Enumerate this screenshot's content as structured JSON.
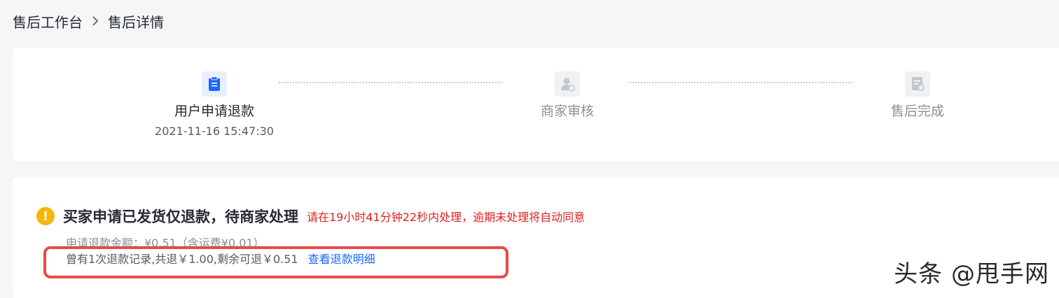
{
  "breadcrumb": {
    "parent": "售后工作台",
    "current": "售后详情"
  },
  "steps": [
    {
      "title": "用户申请退款",
      "time": "2021-11-16 15:47:30",
      "icon": "clipboard-icon",
      "active": true
    },
    {
      "title": "商家审核",
      "time": "",
      "icon": "user-review-icon",
      "active": false
    },
    {
      "title": "售后完成",
      "time": "",
      "icon": "document-check-icon",
      "active": false
    }
  ],
  "status": {
    "title": "买家申请已发货仅退款，待商家处理",
    "deadline": "请在19小时41分钟22秒内处理，逾期未处理将自动同意",
    "apply_amount": "申请退款金额：¥0.51（含运费¥0.01）",
    "record": "曾有1次退款记录,共退￥1.00,剩余可退￥0.51",
    "record_link": "查看退款明细"
  },
  "watermark": "头条 @甩手网",
  "colors": {
    "accent": "#1966ff",
    "warning": "#f5b50a",
    "danger": "#e02020",
    "highlight": "#e84a4a"
  }
}
